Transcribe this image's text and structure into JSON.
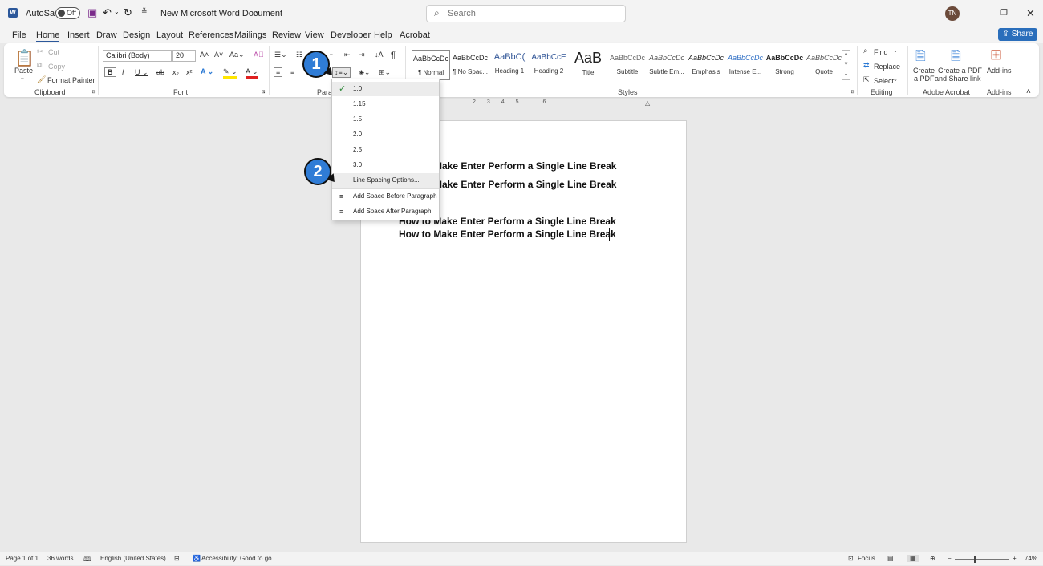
{
  "titlebar": {
    "autosave_label": "AutoSave",
    "autosave_state": "Off",
    "doc_title": "New Microsoft Word Document",
    "search_placeholder": "Search",
    "user_initials": "TN"
  },
  "tabs": [
    "File",
    "Home",
    "Insert",
    "Draw",
    "Design",
    "Layout",
    "References",
    "Mailings",
    "Review",
    "View",
    "Developer",
    "Help",
    "Acrobat"
  ],
  "share_label": "Share",
  "ribbon": {
    "clipboard": {
      "paste": "Paste",
      "cut": "Cut",
      "copy": "Copy",
      "format_painter": "Format Painter",
      "label": "Clipboard"
    },
    "font": {
      "name": "Calibri (Body)",
      "size": "20",
      "label": "Font"
    },
    "paragraph": {
      "label": "Paragraph"
    },
    "styles": {
      "label": "Styles",
      "items": [
        {
          "preview": "AaBbCcDc",
          "name": "¶ Normal"
        },
        {
          "preview": "AaBbCcDc",
          "name": "¶ No Spac..."
        },
        {
          "preview": "AaBbC(",
          "name": "Heading 1"
        },
        {
          "preview": "AaBbCcE",
          "name": "Heading 2"
        },
        {
          "preview": "AaB",
          "name": "Title"
        },
        {
          "preview": "AaBbCcDc",
          "name": "Subtitle"
        },
        {
          "preview": "AaBbCcDc",
          "name": "Subtle Em..."
        },
        {
          "preview": "AaBbCcDc",
          "name": "Emphasis"
        },
        {
          "preview": "AaBbCcDc",
          "name": "Intense E..."
        },
        {
          "preview": "AaBbCcDc",
          "name": "Strong"
        },
        {
          "preview": "AaBbCcDc",
          "name": "Quote"
        }
      ]
    },
    "editing": {
      "find": "Find",
      "replace": "Replace",
      "select": "Select",
      "label": "Editing"
    },
    "acrobat": {
      "create_pdf_1": "Create",
      "create_pdf_2": "a PDF",
      "share_pdf_1": "Create a PDF",
      "share_pdf_2": "and Share link",
      "label": "Adobe Acrobat"
    },
    "addins": {
      "button": "Add-ins",
      "label": "Add-ins"
    }
  },
  "dropdown": {
    "options": [
      "1.0",
      "1.15",
      "1.5",
      "2.0",
      "2.5",
      "3.0"
    ],
    "selected": "1.0",
    "line_spacing_options": "Line Spacing Options...",
    "add_before": "Add Space Before Paragraph",
    "add_after": "Add Space After Paragraph"
  },
  "callouts": [
    "1",
    "2"
  ],
  "document": {
    "lines": [
      "How to Make Enter Perform a Single Line Break",
      "How to Make Enter Perform a Single Line Break",
      "How to Make Enter Perform a Single Line Break",
      "How to Make Enter Perform a Single Line Break"
    ],
    "line1_visible": "Make Enter Perform a Single Line Break",
    "line2_visible": "Make Enter Perform a Single Line Break"
  },
  "statusbar": {
    "page": "Page 1 of 1",
    "words": "36 words",
    "language": "English (United States)",
    "accessibility": "Accessibility: Good to go",
    "focus": "Focus",
    "zoom": "74%"
  },
  "colors": {
    "accent": "#2b579a",
    "callout": "#2f7cd6",
    "share": "#2a6ebb"
  }
}
